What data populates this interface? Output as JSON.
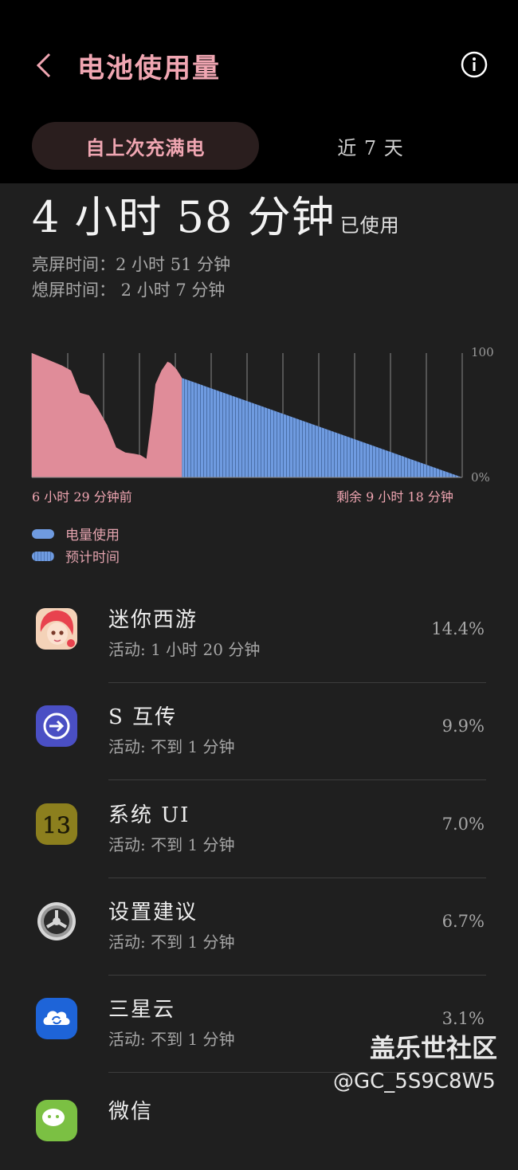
{
  "header": {
    "title": "电池使用量",
    "tabs": [
      {
        "label": "自上次充满电",
        "active": true
      },
      {
        "label": "近 7 天",
        "active": false
      }
    ]
  },
  "usage": {
    "total": "4 小时 58 分钟",
    "total_suffix": "已使用",
    "screen_on": "亮屏时间：2 小时 51 分钟",
    "screen_off": "熄屏时间： 2 小时 7 分钟"
  },
  "chart_data": {
    "type": "area",
    "y_max_label": "100",
    "y_min_label": "0%",
    "ylim": [
      0,
      100
    ],
    "x_start_label": "6 小时 29 分钟前",
    "x_end_label": "剩余 9 小时 18 分钟",
    "used_color": "#e08c99",
    "forecast_color": "#6f9be0",
    "used": {
      "x": [
        0,
        0.5,
        1,
        1.3,
        1.6,
        1.9,
        2.2,
        2.5,
        2.8,
        3.1,
        3.4,
        3.6,
        3.8,
        4.0,
        4.1,
        4.3,
        4.5,
        4.6,
        4.8,
        4.98
      ],
      "y": [
        100,
        95,
        90,
        86,
        68,
        66,
        55,
        42,
        24,
        20,
        19,
        18,
        15,
        52,
        75,
        86,
        93,
        92,
        87,
        80
      ]
    },
    "forecast": {
      "x": [
        4.98,
        14.28
      ],
      "y": [
        80,
        0
      ]
    },
    "x_total": 14.28
  },
  "legend": [
    {
      "label": "电量使用",
      "style": "solid"
    },
    {
      "label": "预计时间",
      "style": "striped"
    }
  ],
  "apps": [
    {
      "name": "迷你西游",
      "active": "活动: 1 小时 20 分钟",
      "percent": "14.4%",
      "icon": "game-avatar-icon"
    },
    {
      "name": "S 互传",
      "active": "活动: 不到 1 分钟",
      "percent": "9.9%",
      "icon": "smart-switch-icon"
    },
    {
      "name": "系统 UI",
      "active": "活动: 不到 1 分钟",
      "percent": "7.0%",
      "icon": "system-ui-icon"
    },
    {
      "name": "设置建议",
      "active": "活动: 不到 1 分钟",
      "percent": "6.7%",
      "icon": "gear-icon"
    },
    {
      "name": "三星云",
      "active": "活动: 不到 1 分钟",
      "percent": "3.1%",
      "icon": "cloud-icon"
    },
    {
      "name": "微信",
      "active": "",
      "percent": "",
      "icon": "wechat-icon"
    }
  ],
  "watermark": {
    "line1": "盖乐世社区",
    "line2": "@GC_5S9C8W5"
  }
}
